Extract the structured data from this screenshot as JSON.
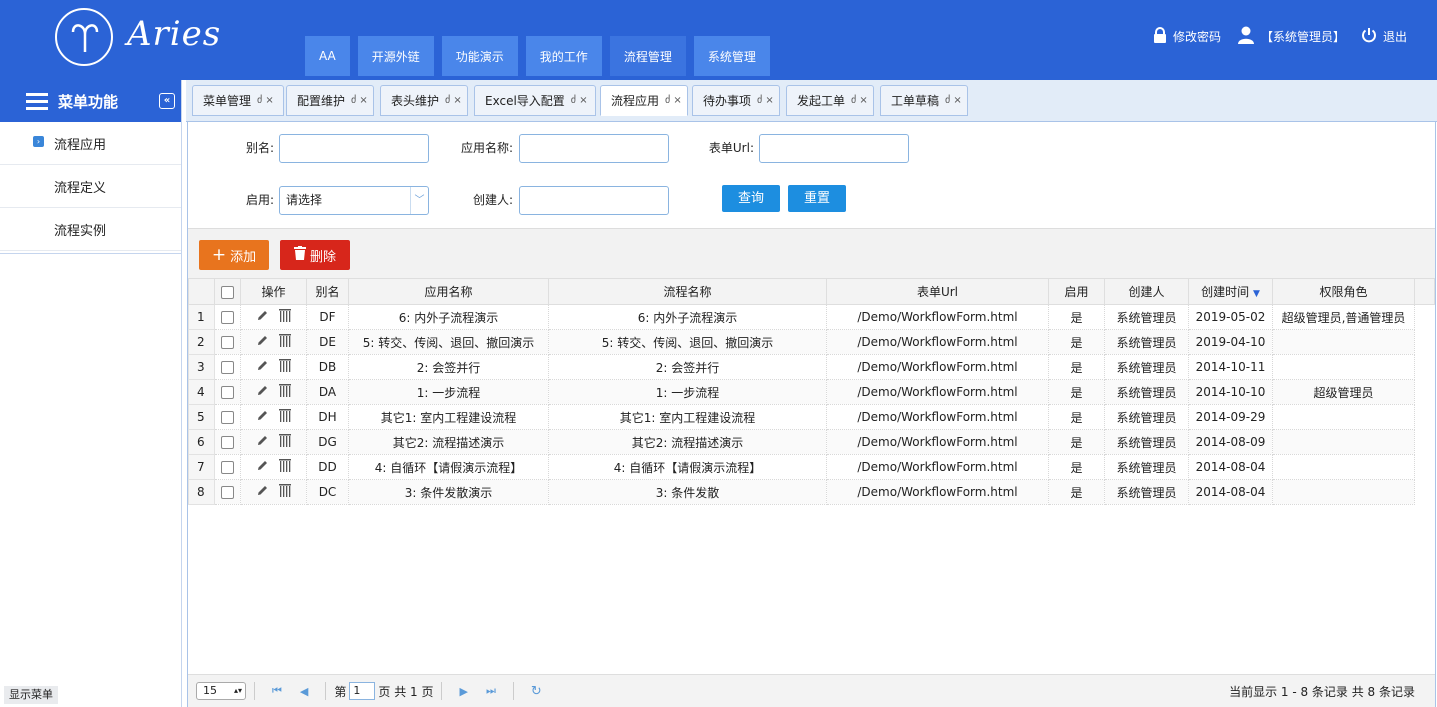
{
  "app": {
    "logo_text": "Aries",
    "nav": [
      "AA",
      "开源外链",
      "功能演示",
      "我的工作",
      "流程管理",
      "系统管理"
    ],
    "active_nav": "流程管理",
    "user_links": {
      "change_password": "修改密码",
      "user": "【系统管理员】",
      "logout": "退出"
    }
  },
  "sidebar": {
    "title": "菜单功能",
    "items": [
      {
        "label": "流程应用"
      },
      {
        "label": "流程定义"
      },
      {
        "label": "流程实例"
      }
    ],
    "show_menu": "显示菜单"
  },
  "tabs": [
    {
      "label": "菜单管理"
    },
    {
      "label": "配置维护"
    },
    {
      "label": "表头维护"
    },
    {
      "label": "Excel导入配置"
    },
    {
      "label": "流程应用",
      "active": true
    },
    {
      "label": "待办事项"
    },
    {
      "label": "发起工单"
    },
    {
      "label": "工单草稿"
    }
  ],
  "tab_controls": "ძ ×",
  "search": {
    "alias_label": "别名:",
    "app_name_label": "应用名称:",
    "form_url_label": "表单Url:",
    "enabled_label": "启用:",
    "enabled_value": "请选择",
    "creator_label": "创建人:",
    "query_button": "查询",
    "reset_button": "重置"
  },
  "toolbar": {
    "add_label": "添加",
    "delete_label": "删除"
  },
  "grid": {
    "columns": [
      "操作",
      "别名",
      "应用名称",
      "流程名称",
      "表单Url",
      "启用",
      "创建人",
      "创建时间",
      "权限角色"
    ],
    "rows": [
      {
        "n": "1",
        "alias": "DF",
        "app": "6: 内外子流程演示",
        "flow": "6: 内外子流程演示",
        "url": "/Demo/WorkflowForm.html",
        "enabled": "是",
        "creator": "系统管理员",
        "created": "2019-05-02",
        "roles": "超级管理员,普通管理员"
      },
      {
        "n": "2",
        "alias": "DE",
        "app": "5: 转交、传阅、退回、撤回演示",
        "flow": "5: 转交、传阅、退回、撤回演示",
        "url": "/Demo/WorkflowForm.html",
        "enabled": "是",
        "creator": "系统管理员",
        "created": "2019-04-10",
        "roles": ""
      },
      {
        "n": "3",
        "alias": "DB",
        "app": "2: 会签并行",
        "flow": "2: 会签并行",
        "url": "/Demo/WorkflowForm.html",
        "enabled": "是",
        "creator": "系统管理员",
        "created": "2014-10-11",
        "roles": ""
      },
      {
        "n": "4",
        "alias": "DA",
        "app": "1: 一步流程",
        "flow": "1: 一步流程",
        "url": "/Demo/WorkflowForm.html",
        "enabled": "是",
        "creator": "系统管理员",
        "created": "2014-10-10",
        "roles": "超级管理员"
      },
      {
        "n": "5",
        "alias": "DH",
        "app": "其它1: 室内工程建设流程",
        "flow": "其它1: 室内工程建设流程",
        "url": "/Demo/WorkflowForm.html",
        "enabled": "是",
        "creator": "系统管理员",
        "created": "2014-09-29",
        "roles": ""
      },
      {
        "n": "6",
        "alias": "DG",
        "app": "其它2: 流程描述演示",
        "flow": "其它2: 流程描述演示",
        "url": "/Demo/WorkflowForm.html",
        "enabled": "是",
        "creator": "系统管理员",
        "created": "2014-08-09",
        "roles": ""
      },
      {
        "n": "7",
        "alias": "DD",
        "app": "4: 自循环【请假演示流程】",
        "flow": "4: 自循环【请假演示流程】",
        "url": "/Demo/WorkflowForm.html",
        "enabled": "是",
        "creator": "系统管理员",
        "created": "2014-08-04",
        "roles": ""
      },
      {
        "n": "8",
        "alias": "DC",
        "app": "3: 条件发散演示",
        "flow": "3: 条件发散",
        "url": "/Demo/WorkflowForm.html",
        "enabled": "是",
        "creator": "系统管理员",
        "created": "2014-08-04",
        "roles": ""
      }
    ]
  },
  "pager": {
    "page_size": "15",
    "page_prefix": "第",
    "page_number": "1",
    "page_suffix": "页 共 1 页",
    "info": "当前显示 1 - 8 条记录 共 8 条记录"
  },
  "colors": {
    "header": "#2b63d6",
    "add_button": "#e8741e",
    "delete_button": "#d7261b",
    "query_button": "#1d8ee0"
  }
}
